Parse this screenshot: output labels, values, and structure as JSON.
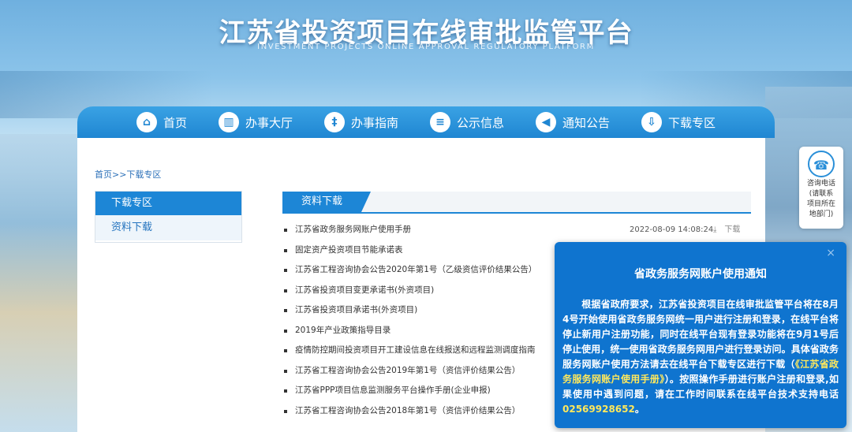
{
  "site": {
    "title": "江苏省投资项目在线审批监管平台",
    "subtitle": "INVESTMENT PROJECTS ONLINE APPROVAL REGULATORY PLATFORM"
  },
  "nav": [
    {
      "label": "首页",
      "icon": "home-icon"
    },
    {
      "label": "办事大厅",
      "icon": "book-icon"
    },
    {
      "label": "办事指南",
      "icon": "signpost-icon"
    },
    {
      "label": "公示信息",
      "icon": "document-icon"
    },
    {
      "label": "通知公告",
      "icon": "megaphone-icon"
    },
    {
      "label": "下载专区",
      "icon": "download-icon"
    }
  ],
  "breadcrumb": "首页>>下载专区",
  "sidebar": {
    "heading": "下载专区",
    "items": [
      "资料下载"
    ]
  },
  "content": {
    "tab": "资料下载",
    "download_label": "下载",
    "files": [
      {
        "title": "江苏省政务服务网账户使用手册",
        "date": "2022-08-09 14:08:24"
      },
      {
        "title": "固定资产投资项目节能承诺表"
      },
      {
        "title": "江苏省工程咨询协会公告2020年第1号（乙级资信评价结果公告）"
      },
      {
        "title": "江苏省投资项目变更承诺书(外资项目)"
      },
      {
        "title": "江苏省投资项目承诺书(外资项目)"
      },
      {
        "title": "2019年产业政策指导目录"
      },
      {
        "title": "疫情防控期间投资项目开工建设信息在线报送和远程监测调度指南"
      },
      {
        "title": "江苏省工程咨询协会公告2019年第1号（资信评价结果公告）"
      },
      {
        "title": "江苏省PPP项目信息监测服务平台操作手册(企业申报)"
      },
      {
        "title": "江苏省工程咨询协会公告2018年第1号（资信评价结果公告）"
      }
    ]
  },
  "consult": {
    "label1": "咨询电话",
    "label2": "(请联系",
    "label3": "项目所在",
    "label4": "地部门)"
  },
  "notice": {
    "close": "×",
    "title": "省政务服务网账户使用通知",
    "body_part1": "根据省政府要求，江苏省投资项目在线审批监管平台将在8月4号开始使用省政务服务网统一用户进行注册和登录，在线平台将停止新用户注册功能，同时在线平台现有登录功能将在9月1号后停止使用，统一使用省政务服务网用户进行登录访问。具体省政务服务网账户使用方法请去在线平台下载专区进行下载（",
    "body_link": "《江苏省政务服务网账户使用手册》",
    "body_part2": "）。按照操作手册进行账户注册和登录,如果使用中遇到问题，请在工作时间联系在线平台技术支持电话",
    "phone": "02569928652",
    "body_end": "。",
    "highlight_color": "#ffe85c"
  }
}
